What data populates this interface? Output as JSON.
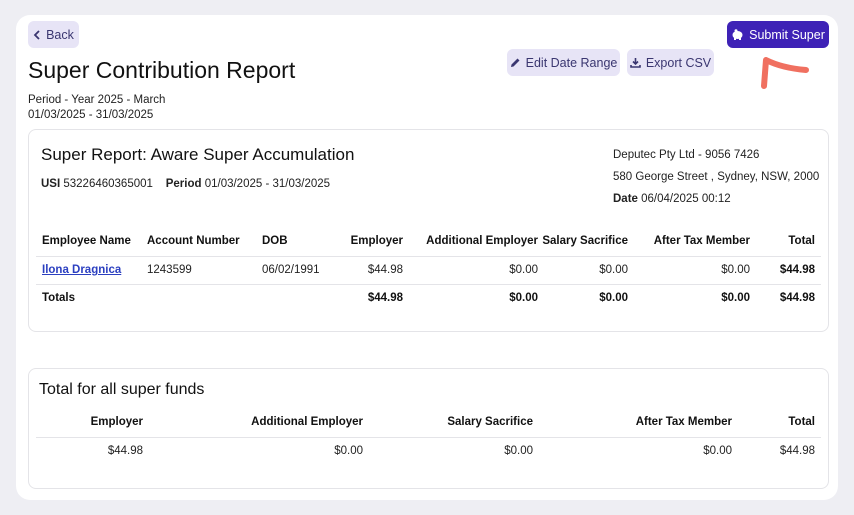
{
  "header": {
    "back_label": "Back",
    "edit_date_label": "Edit Date Range",
    "export_label": "Export CSV",
    "submit_label": "Submit Super",
    "title": "Super Contribution Report",
    "period_line1": "Period - Year 2025 - March",
    "period_line2": "01/03/2025 - 31/03/2025"
  },
  "report": {
    "title": "Super Report: Aware Super Accumulation",
    "usi_label": "USI",
    "usi_value": "53226460365001",
    "period_label": "Period",
    "period_value": "01/03/2025 - 31/03/2025",
    "company_line": "Deputec Pty Ltd - 9056 7426",
    "address_line": "580 George Street , Sydney, NSW, 2000",
    "date_label": "Date",
    "date_value": "06/04/2025 00:12",
    "columns": [
      "Employee Name",
      "Account Number",
      "DOB",
      "Employer",
      "Additional Employer",
      "Salary Sacrifice",
      "After Tax Member",
      "Total"
    ],
    "rows": [
      {
        "name": "Ilona Dragnica",
        "account": "1243599",
        "dob": "06/02/1991",
        "employer": "$44.98",
        "additional": "$0.00",
        "sacrifice": "$0.00",
        "after_tax": "$0.00",
        "total": "$44.98"
      }
    ],
    "totals": {
      "label": "Totals",
      "employer": "$44.98",
      "additional": "$0.00",
      "sacrifice": "$0.00",
      "after_tax": "$0.00",
      "total": "$44.98"
    }
  },
  "all_funds": {
    "title": "Total for all super funds",
    "columns": [
      "Employer",
      "Additional Employer",
      "Salary Sacrifice",
      "After Tax Member",
      "Total"
    ],
    "values": {
      "employer": "$44.98",
      "additional": "$0.00",
      "sacrifice": "$0.00",
      "after_tax": "$0.00",
      "total": "$44.98"
    }
  },
  "icons": {
    "back": "chevron-left-icon",
    "edit": "pencil-icon",
    "export": "download-icon",
    "submit": "piggy-bank-icon",
    "annotation": "arrow-annotation-icon"
  },
  "colors": {
    "primary": "#3e22b6",
    "soft_button": "#e7e4f6",
    "link": "#2b3fc0",
    "annotation": "#f07060"
  }
}
